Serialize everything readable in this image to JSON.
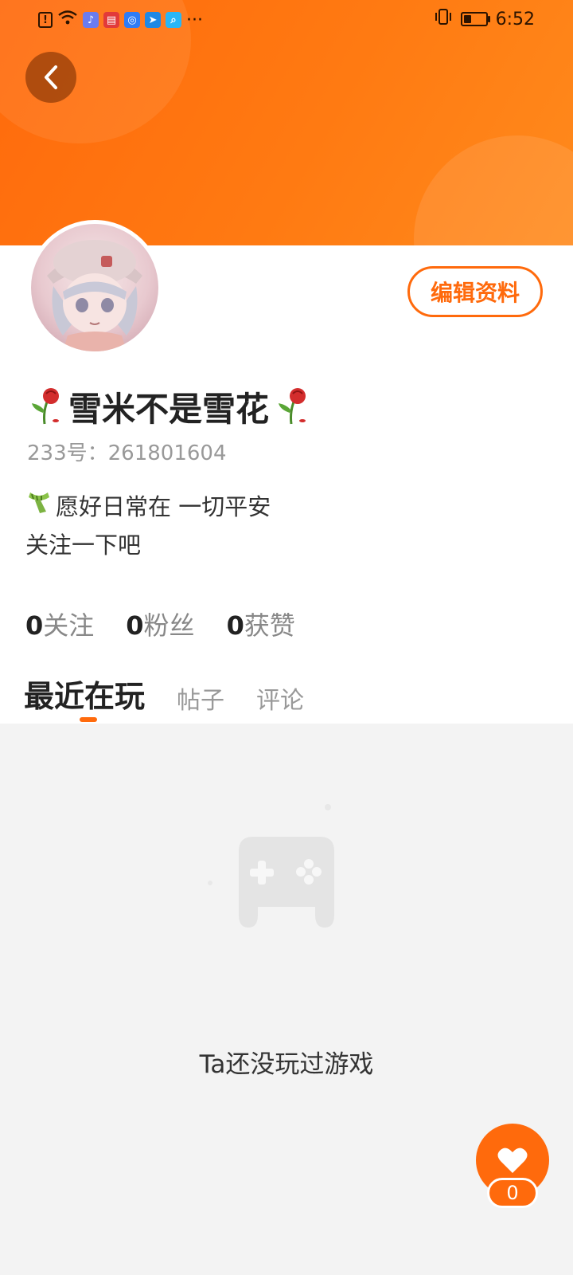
{
  "status_bar": {
    "time": "6:52",
    "more": "···",
    "battery_level": 0.35
  },
  "profile": {
    "name": "雪米不是雪花",
    "id_label": "233号：",
    "id_value": "261801604",
    "bio_line1": "愿好日常在 一切平安",
    "bio_line2": "关注一下吧",
    "edit_label": "编辑资料"
  },
  "stats": [
    {
      "num": "0",
      "label": "关注"
    },
    {
      "num": "0",
      "label": "粉丝"
    },
    {
      "num": "0",
      "label": "获赞"
    }
  ],
  "tabs": [
    "最近在玩",
    "帖子",
    "评论"
  ],
  "empty": {
    "message": "Ta还没玩过游戏"
  },
  "fab": {
    "count": "0"
  },
  "colors": {
    "accent": "#ff6a0c",
    "header_start": "#ff6a0c",
    "header_end": "#ff8a1c"
  }
}
